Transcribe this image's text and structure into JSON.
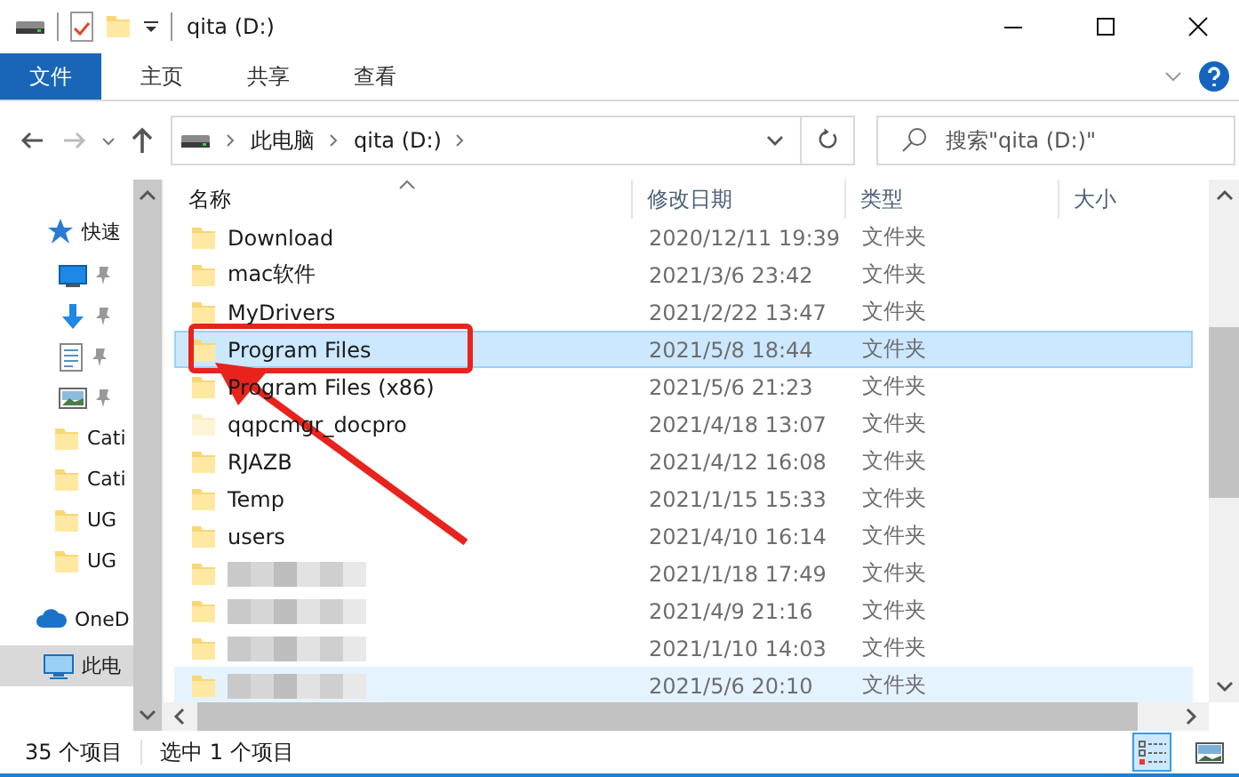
{
  "window": {
    "title": "qita (D:)"
  },
  "ribbon_tabs": [
    {
      "label": "文件",
      "selected": true
    },
    {
      "label": "主页",
      "selected": false
    },
    {
      "label": "共享",
      "selected": false
    },
    {
      "label": "查看",
      "selected": false
    }
  ],
  "address": {
    "forward_disabled": true,
    "breadcrumb": [
      "此电脑",
      "qita (D:)"
    ]
  },
  "search": {
    "placeholder": "搜索\"qita (D:)\""
  },
  "nav": [
    {
      "kind": "star",
      "label": "快速",
      "selected": false
    },
    {
      "kind": "desktop",
      "pinned": true,
      "selected": false
    },
    {
      "kind": "download",
      "pinned": true,
      "selected": false
    },
    {
      "kind": "document",
      "pinned": true,
      "selected": false
    },
    {
      "kind": "picture",
      "pinned": true,
      "selected": false
    },
    {
      "kind": "folder",
      "label": "Cati",
      "selected": false
    },
    {
      "kind": "folder",
      "label": "Cati",
      "selected": false
    },
    {
      "kind": "folder",
      "label": "UG",
      "selected": false
    },
    {
      "kind": "folder",
      "label": "UG",
      "selected": false
    },
    {
      "kind": "cloud",
      "label": "OneD",
      "selected": false
    },
    {
      "kind": "computer",
      "label": "此电",
      "selected": true
    }
  ],
  "table": {
    "columns": [
      "名称",
      "修改日期",
      "类型",
      "大小"
    ],
    "rows": [
      {
        "name": "Download",
        "date": "2020/12/11 19:39",
        "type": "文件夹",
        "selected": false,
        "hover": false
      },
      {
        "name": "mac软件",
        "date": "2021/3/6 23:42",
        "type": "文件夹",
        "selected": false,
        "hover": false
      },
      {
        "name": "MyDrivers",
        "date": "2021/2/22 13:47",
        "type": "文件夹",
        "selected": false,
        "hover": false
      },
      {
        "name": "Program Files",
        "date": "2021/5/8 18:44",
        "type": "文件夹",
        "selected": true,
        "hover": false
      },
      {
        "name": "Program Files (x86)",
        "date": "2021/5/6 21:23",
        "type": "文件夹",
        "selected": false,
        "hover": false
      },
      {
        "name": "qqpcmgr_docpro",
        "date": "2021/4/18 13:07",
        "type": "文件夹",
        "selected": false,
        "hover": false,
        "hidden": true
      },
      {
        "name": "RJAZB",
        "date": "2021/4/12 16:08",
        "type": "文件夹",
        "selected": false,
        "hover": false
      },
      {
        "name": "Temp",
        "date": "2021/1/15 15:33",
        "type": "文件夹",
        "selected": false,
        "hover": false
      },
      {
        "name": "users",
        "date": "2021/4/10 16:14",
        "type": "文件夹",
        "selected": false,
        "hover": false
      },
      {
        "date": "2021/1/18 17:49",
        "type": "文件夹",
        "selected": false,
        "hover": false
      },
      {
        "date": "2021/4/9 21:16",
        "type": "文件夹",
        "selected": false,
        "hover": false
      },
      {
        "date": "2021/1/10 14:03",
        "type": "文件夹",
        "selected": false,
        "hover": false
      },
      {
        "date": "2021/5/6 20:10",
        "type": "文件夹",
        "selected": false,
        "hover": true
      }
    ]
  },
  "status_bar": {
    "count": "35 个项目",
    "selection": "选中 1 个项目",
    "views": [
      {
        "kind": "details",
        "selected": true
      },
      {
        "kind": "large",
        "selected": false
      }
    ]
  }
}
